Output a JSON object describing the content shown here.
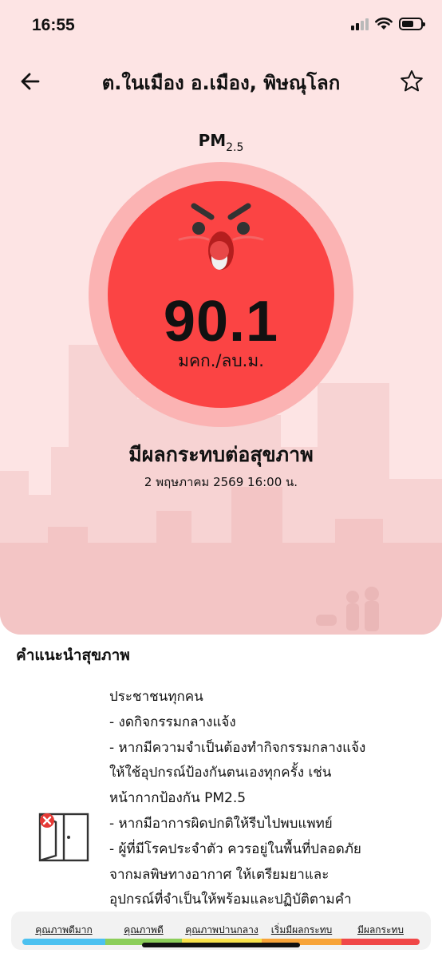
{
  "status_bar": {
    "time": "16:55"
  },
  "header": {
    "location": "ต.ในเมือง อ.เมือง, พิษณุโลก"
  },
  "measurement": {
    "pollutant": "PM",
    "pollutant_sub": "2.5",
    "value": "90.1",
    "unit": "มคก./ลบ.ม.",
    "level": "มีผลกระทบต่อสุขภาพ",
    "updated": "2 พฤษภาคม 2569  16:00 น."
  },
  "advice": {
    "title": "คำแนะนำสุขภาพ",
    "lines": [
      "ประชาชนทุกคน",
      " - งดกิจกรรมกลางแจ้ง",
      " - หากมีความจำเป็นต้องทำกิจกรรมกลางแจ้ง",
      "ให้ใช้อุปกรณ์ป้องกันตนเองทุกครั้ง เช่น",
      "หน้ากากป้องกัน PM2.5",
      " - หากมีอาการผิดปกติให้รีบไปพบแพทย์",
      " - ผู้ที่มีโรคประจำตัว ควรอยู่ในพื้นที่ปลอดภัย",
      "จากมลพิษทางอากาศ  ให้เตรียมยาและ",
      "อุปกรณ์ที่จำเป็นให้พร้อมและปฏิบัติตามคำ"
    ]
  },
  "legend": [
    {
      "label": "คุณภาพดีมาก",
      "color": "#4cc1f0"
    },
    {
      "label": "คุณภาพดี",
      "color": "#8cce5a"
    },
    {
      "label": "คุณภาพปานกลาง",
      "color": "#f7e14a"
    },
    {
      "label": "เริ่มมีผลกระทบ",
      "color": "#f7a338"
    },
    {
      "label": "มีผลกระทบ",
      "color": "#f04848"
    }
  ],
  "colors": {
    "hero_background": "#fde4e4",
    "outer_ring": "#fbb3b3",
    "inner_circle": "#fb4444"
  },
  "icons": {
    "back": "arrow-left-icon",
    "favorite": "star-icon",
    "advice": "window-door-icon"
  }
}
